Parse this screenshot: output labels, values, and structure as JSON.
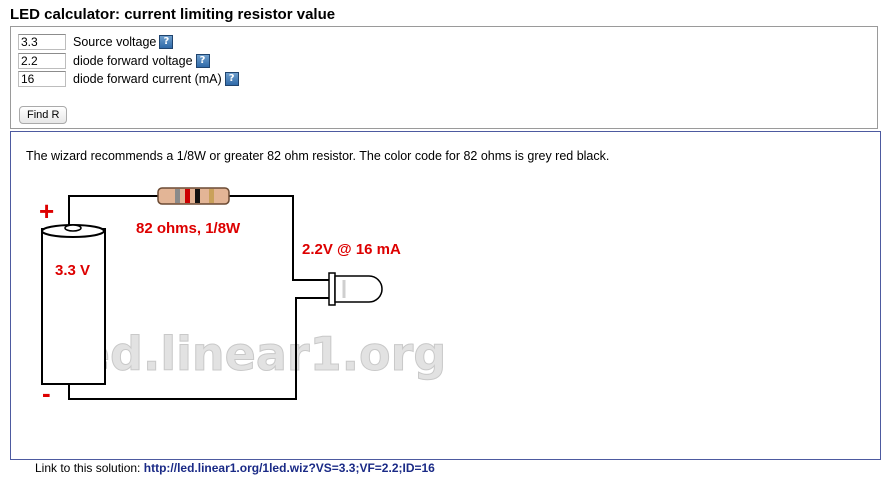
{
  "title": "LED calculator: current limiting resistor value",
  "inputs": [
    {
      "value": "3.3",
      "label": "Source voltage"
    },
    {
      "value": "2.2",
      "label": "diode forward voltage"
    },
    {
      "value": "16",
      "label": "diode forward current (mA)"
    }
  ],
  "help_glyph": "?",
  "find_button": "Find R",
  "recommendation": "The wizard recommends a 1/8W or greater 82 ohm resistor. The color code for 82 ohms is grey red black.",
  "diagram": {
    "plus": "+",
    "minus": "-",
    "battery_voltage": "3.3 V",
    "resistor_label": "82 ohms, 1/8W",
    "led_label": "2.2V @ 16 mA",
    "watermark": "led.linear1.org",
    "label_color": "#dd0000",
    "resistor_bands": [
      "grey",
      "red",
      "black"
    ]
  },
  "link": {
    "prefix": "Link to this solution:",
    "url": "http://led.linear1.org/1led.wiz?VS=3.3;VF=2.2;ID=16"
  }
}
